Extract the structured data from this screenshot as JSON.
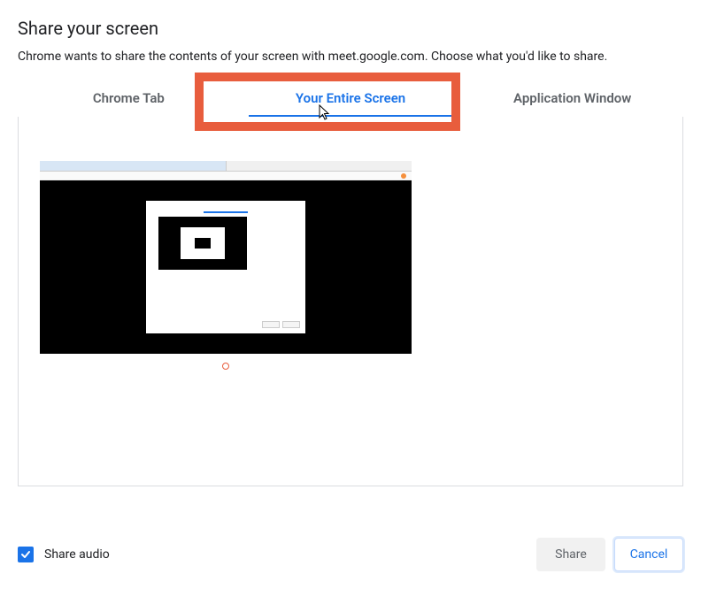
{
  "dialog": {
    "title": "Share your screen",
    "subtitle": "Chrome wants to share the contents of your screen with meet.google.com. Choose what you'd like to share."
  },
  "tabs": {
    "chrome_tab": "Chrome Tab",
    "entire_screen": "Your Entire Screen",
    "app_window": "Application Window",
    "active": "entire_screen"
  },
  "audio": {
    "label": "Share audio",
    "checked": true
  },
  "buttons": {
    "share": "Share",
    "cancel": "Cancel"
  }
}
